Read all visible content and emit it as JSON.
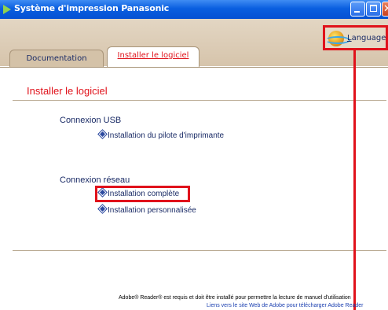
{
  "window": {
    "title": "Système d'impression Panasonic"
  },
  "tabs": [
    {
      "label": "Documentation",
      "active": false
    },
    {
      "label": "Installer le logiciel",
      "active": true
    }
  ],
  "language_button": {
    "label": "Language",
    "icon": "globe-icon"
  },
  "main": {
    "section_title": "Installer le logiciel",
    "usb": {
      "title": "Connexion USB",
      "links": [
        "Installation du pilote d'imprimante"
      ]
    },
    "network": {
      "title": "Connexion réseau",
      "links": [
        "Installation complète",
        "Installation personnalisée"
      ]
    }
  },
  "footer": {
    "note": "Adobe® Reader® est requis et doit être installé pour permettre la lecture de manuel d'utilisation",
    "link": "Liens vers le site Web de Adobe pour télécharger Adobe Reader"
  },
  "colors": {
    "accent_red": "#e0121b",
    "titlebar_blue": "#0a5fe0",
    "tab_band": "#d6c4ab",
    "link_navy": "#1a2b66"
  }
}
